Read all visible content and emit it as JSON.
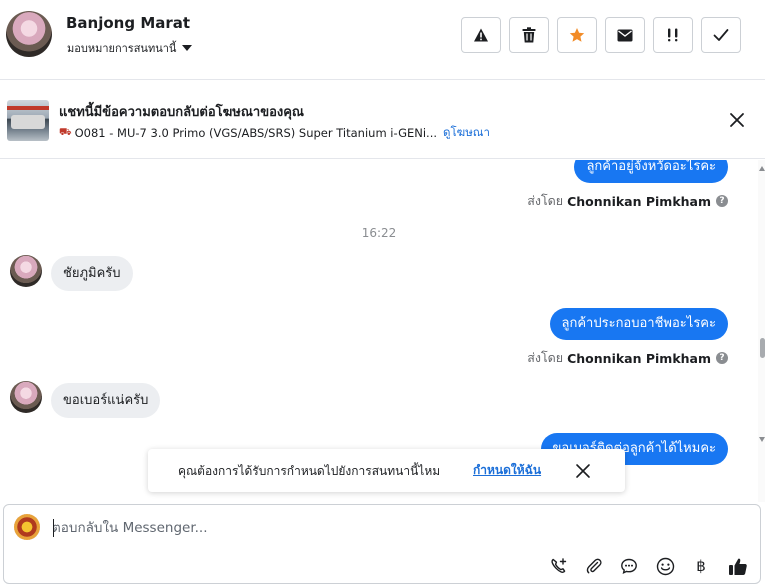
{
  "header": {
    "contact_name": "Banjong Marat",
    "assign_label": "มอบหมายการสนทนานี้",
    "actions": [
      {
        "name": "report-spam",
        "icon": "warning-icon"
      },
      {
        "name": "delete",
        "icon": "trash-icon"
      },
      {
        "name": "star",
        "icon": "star-icon",
        "color": "#f28c28"
      },
      {
        "name": "mark-unread",
        "icon": "envelope-icon"
      },
      {
        "name": "follow-up",
        "icon": "exclamation-icon",
        "label": "!!"
      },
      {
        "name": "mark-done",
        "icon": "check-icon"
      }
    ]
  },
  "ad_banner": {
    "title": "แชทนี้มีข้อความตอบกลับต่อโฆษณาของคุณ",
    "product": "O081 - MU-7 3.0 Primo (VGS/ABS/SRS) Super Titanium i-GENi...",
    "link_label": "ดูโฆษณา"
  },
  "thread": {
    "messages": [
      {
        "direction": "out",
        "text": "ลูกค้าอยู่จังหวัดอะไรคะ"
      },
      {
        "type": "sent_by",
        "prefix": "ส่งโดย",
        "agent": "Chonnikan Pimkham"
      },
      {
        "type": "time",
        "text": "16:22"
      },
      {
        "direction": "in",
        "text": "ชัยภูมิครับ"
      },
      {
        "direction": "out",
        "text": "ลูกค้าประกอบอาชีพอะไรคะ"
      },
      {
        "type": "sent_by",
        "prefix": "ส่งโดย",
        "agent": "Chonnikan Pimkham"
      },
      {
        "direction": "in",
        "text": "ขอเบอร์แน่ครับ"
      },
      {
        "direction": "out",
        "text": "ขอเบอร์ติดต่อลูกค้าได้ไหมคะ"
      }
    ]
  },
  "toast": {
    "text": "คุณต้องการได้รับการกำหนดไปยังการสนทนานี้ไหม",
    "link_label": "กำหนดให้ฉัน"
  },
  "composer": {
    "placeholder": "ตอบกลับใน Messenger...",
    "tools": [
      "phone-add-icon",
      "paperclip-icon",
      "saved-reply-icon",
      "emoji-icon",
      "baht-icon",
      "thumbs-up-icon"
    ],
    "baht_symbol": "฿"
  },
  "colors": {
    "accent": "#1877f2",
    "link": "#1a6ed8",
    "star": "#f28c28",
    "incoming_bubble": "#eceef1"
  }
}
